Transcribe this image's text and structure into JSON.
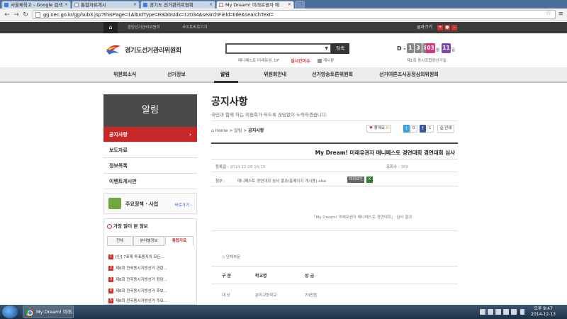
{
  "browser": {
    "tabs": [
      {
        "label": "서울체육고 - Google 검색"
      },
      {
        "label": "통합자유게시"
      },
      {
        "label": "경기도 선거관리위원회"
      },
      {
        "label": "My Dream! 미래유권자 에"
      }
    ],
    "url": "gg.nec.go.kr/gg/sub3.jsp?thisPage=1&lbrdType=R&bbsIdx=12034&searchField=title&searchText="
  },
  "topstrip": {
    "links": [
      "중앙선거관리위원회",
      "사이트바로가기"
    ],
    "zoom_label": "글자크기",
    "zoom_plus": "+",
    "zoom_minus": "-",
    "zoom_reset": "●"
  },
  "header": {
    "logo_text": "경기도선거관리위원회",
    "search_placeholder": "",
    "search_button": "검색",
    "hint_manifesto": "매니페스토  미래유권,  DF",
    "hint_live": "실시간이슈",
    "hint_open": "게시판",
    "dday_label": "D -",
    "dday_digits": [
      "1",
      "3",
      "8"
    ],
    "date_month": "03",
    "date_month_unit": "월",
    "date_day": "11",
    "date_day_unit": "일",
    "election_note": "제1회 동시조합장선거일"
  },
  "gnb": [
    "위원회소식",
    "선거정보",
    "알림",
    "위원회안내",
    "선거방송토론위원회",
    "선거여론조사공정심의위원회"
  ],
  "lnb": {
    "title": "알림",
    "items": [
      {
        "label": "공지사항",
        "arrow": "›"
      },
      {
        "label": "보도자료"
      },
      {
        "label": "정보목록"
      },
      {
        "label": "이벤트게시판"
      }
    ],
    "policy_title": "주요정책 · 사업",
    "policy_more": "바로가기 ›"
  },
  "viewed": {
    "title": "가장 많이 본 정보",
    "tabs": [
      "전체",
      "분야별정보",
      "통합자료"
    ],
    "items": [
      {
        "num": "1",
        "text": "[인] 7포제 투표용지의 모든..."
      },
      {
        "num": "2",
        "text": "제6회 전국동시지방선거 관련..."
      },
      {
        "num": "3",
        "text": "제6회 전국동시지방선거 정당..."
      },
      {
        "num": "4",
        "text": "제6회 전국동시지방선거 후보..."
      },
      {
        "num": "5",
        "text": "제6회 전국동시지방선거 주요..."
      }
    ]
  },
  "content": {
    "page_title": "공지사항",
    "page_sub": "국민과 함께 하는 위원회가 되도록 끊임없이 노력하겠습니다.",
    "breadcrumb": {
      "home": "Home",
      "sep1": " > ",
      "level1": "알림",
      "sep2": " > ",
      "current": "공지사항"
    },
    "share": {
      "like": "좋아요",
      "like_count": "0",
      "social1": "0",
      "social2": "1",
      "print": "인쇄"
    },
    "post_title": "My Dream! 미래유권자 매니페스토 경연대회 경연대회 심사",
    "reg_label": "등록일 :",
    "reg_value": "2014-12-08 16:19",
    "views_label": "조회수 :",
    "views_value": "389",
    "attach_label": "첨부 :",
    "attach_name": "매니페스토 경연대회 심사 결과(홈페이지 게시용).xlsx",
    "preview_btn": "미리보기",
    "body_text": "「My Dream! 미래유권자 매니페스토 경연대회」  심사 결과",
    "section_label": "◇ 단체부문",
    "table_headers": [
      "구  분",
      "학교명",
      "상  금"
    ],
    "table_row": [
      "대    상",
      "분리고등학교",
      "70만원"
    ]
  },
  "taskbar": {
    "task_label": "My Dream! 미래...",
    "time": "오후 9:47",
    "date": "2014-12-13"
  }
}
